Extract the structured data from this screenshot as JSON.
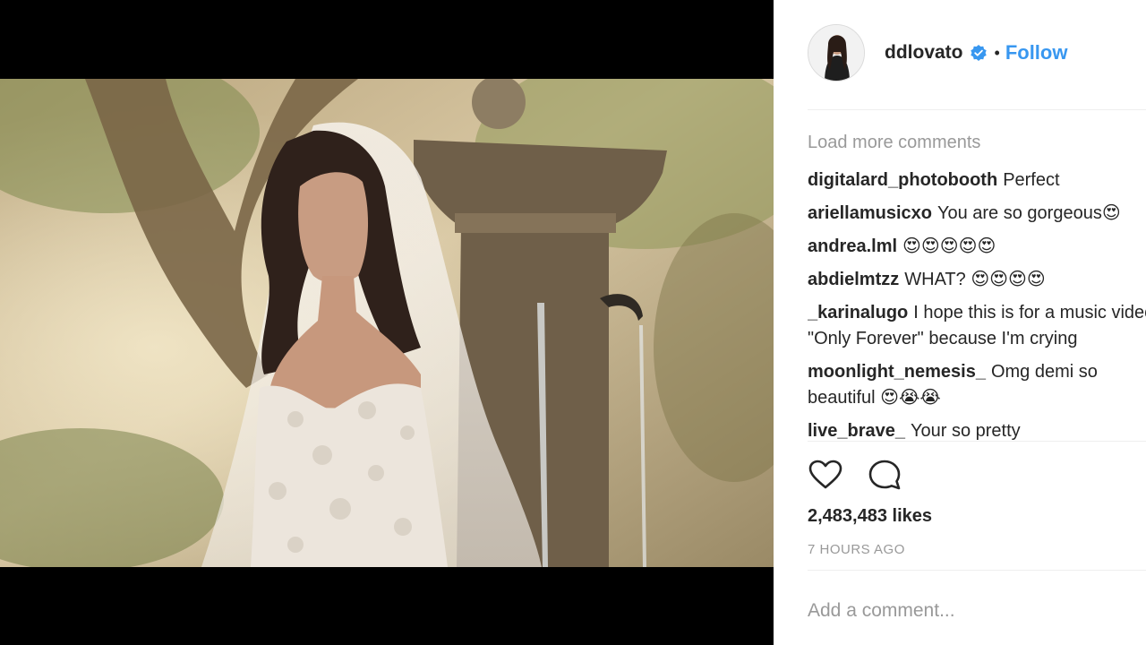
{
  "post": {
    "username": "ddlovato",
    "follow_label": "Follow",
    "dot": "•",
    "load_more": "Load more comments",
    "comments": [
      {
        "author": "digitalard_photobooth",
        "text": "Perfect"
      },
      {
        "author": "ariellamusicxo",
        "text": "You are so gorgeous😍"
      },
      {
        "author": "andrea.lml",
        "text": "😍😍😍😍😍"
      },
      {
        "author": "abdielmtzz",
        "text": "WHAT? 😍😍😍😍"
      },
      {
        "author": "_karinalugo",
        "text": "I hope this is for a music video for \"Only Forever\" because I'm crying"
      },
      {
        "author": "moonlight_nemesis_",
        "text": "Omg demi so beautiful 😍😭😭"
      },
      {
        "author": "live_brave_",
        "text": "Your so pretty"
      }
    ],
    "likes": "2,483,483 likes",
    "timestamp": "7 HOURS AGO",
    "add_comment_placeholder": "Add a comment..."
  },
  "icons": {
    "like": "heart-icon",
    "comment": "comment-bubble-icon",
    "verified": "verified-badge-icon"
  },
  "colors": {
    "accent": "#3897f0",
    "text": "#262626",
    "muted": "#999999"
  }
}
